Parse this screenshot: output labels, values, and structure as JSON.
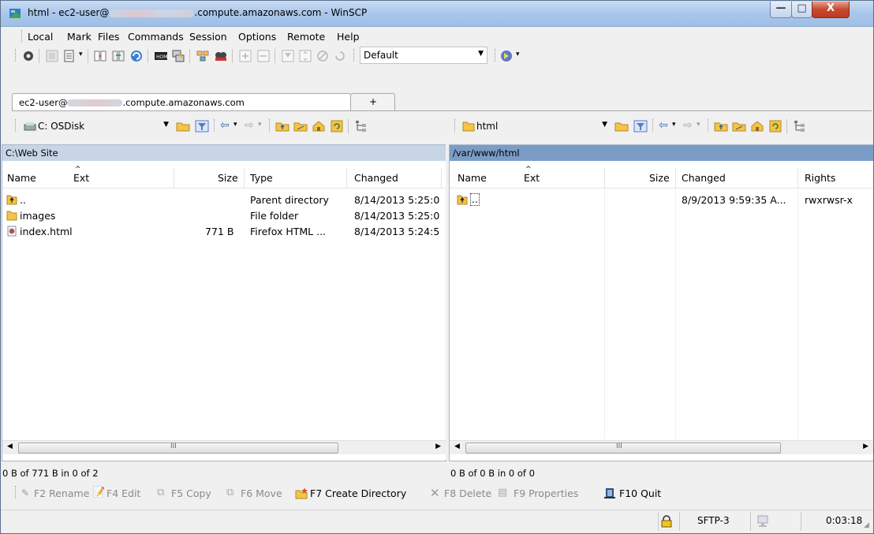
{
  "window": {
    "title_prefix": "html - ec2-user@",
    "title_suffix": ".compute.amazonaws.com - WinSCP",
    "minimize": "—",
    "maximize": "□",
    "close": "X"
  },
  "menu": {
    "items": [
      "Local",
      "Mark",
      "Files",
      "Commands",
      "Session",
      "Options",
      "Remote",
      "Help"
    ]
  },
  "toolbar": {
    "transfer_settings": "Default"
  },
  "tabs": {
    "session_prefix": "ec2-user@",
    "session_suffix": ".compute.amazonaws.com",
    "new_tab": "+"
  },
  "local": {
    "drive": "C: OSDisk",
    "path": "C:\\Web Site",
    "columns": [
      "Name",
      "Ext",
      "Size",
      "Type",
      "Changed"
    ],
    "rows": [
      {
        "name": "..",
        "size": "",
        "type": "Parent directory",
        "changed": "8/14/2013 5:25:0",
        "icon": "parent-folder-icon"
      },
      {
        "name": "images",
        "size": "",
        "type": "File folder",
        "changed": "8/14/2013 5:25:0",
        "icon": "folder-icon"
      },
      {
        "name": "index.html",
        "size": "771 B",
        "type": "Firefox HTML ...",
        "changed": "8/14/2013 5:24:5",
        "icon": "html-file-icon"
      }
    ],
    "status": "0 B of 771 B in 0 of 2",
    "scroll_mid": "III"
  },
  "remote": {
    "folder": "html",
    "path": "/var/www/html",
    "columns": [
      "Name",
      "Ext",
      "Size",
      "Changed",
      "Rights"
    ],
    "rows": [
      {
        "name": "..",
        "changed": "8/9/2013 9:59:35 A...",
        "rights": "rwxrwsr-x"
      }
    ],
    "status": "0 B of 0 B in 0 of 0",
    "scroll_mid": "III"
  },
  "fkeys": [
    {
      "label": "F2 Rename",
      "enabled": false
    },
    {
      "label": "F4 Edit",
      "enabled": false
    },
    {
      "label": "F5 Copy",
      "enabled": false
    },
    {
      "label": "F6 Move",
      "enabled": false
    },
    {
      "label": "F7 Create Directory",
      "enabled": true
    },
    {
      "label": "F8 Delete",
      "enabled": false
    },
    {
      "label": "F9 Properties",
      "enabled": false
    },
    {
      "label": "F10 Quit",
      "enabled": true
    }
  ],
  "statusbar": {
    "protocol": "SFTP-3",
    "elapsed": "0:03:18"
  },
  "colors": {
    "active_panel_header": "#7b9cc6",
    "inactive_panel_header": "#c7d5e6",
    "folder": "#f3c34a"
  }
}
